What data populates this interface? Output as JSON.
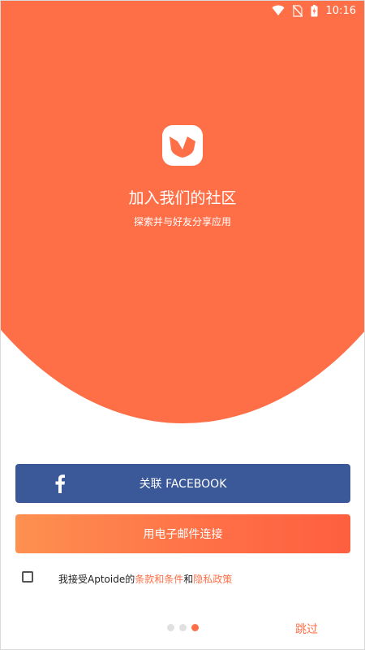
{
  "status_bar": {
    "time": "10:16",
    "icons": [
      "wifi-icon",
      "no-sim-icon",
      "battery-charging-icon"
    ]
  },
  "onboarding": {
    "title": "加入我们的社区",
    "subtitle": "探索并与好友分享应用"
  },
  "buttons": {
    "facebook_label": "关联 FACEBOOK",
    "email_label": "用电子邮件连接",
    "skip_label": "跳过"
  },
  "terms": {
    "prefix": "我接受Aptoide的",
    "terms_link": "条款和条件",
    "conjunction": "和",
    "privacy_link": "隐私政策",
    "checked": false
  },
  "pagination": {
    "total": 3,
    "active": 3
  },
  "colors": {
    "accent": "#ff6f47",
    "facebook": "#3b5999"
  }
}
